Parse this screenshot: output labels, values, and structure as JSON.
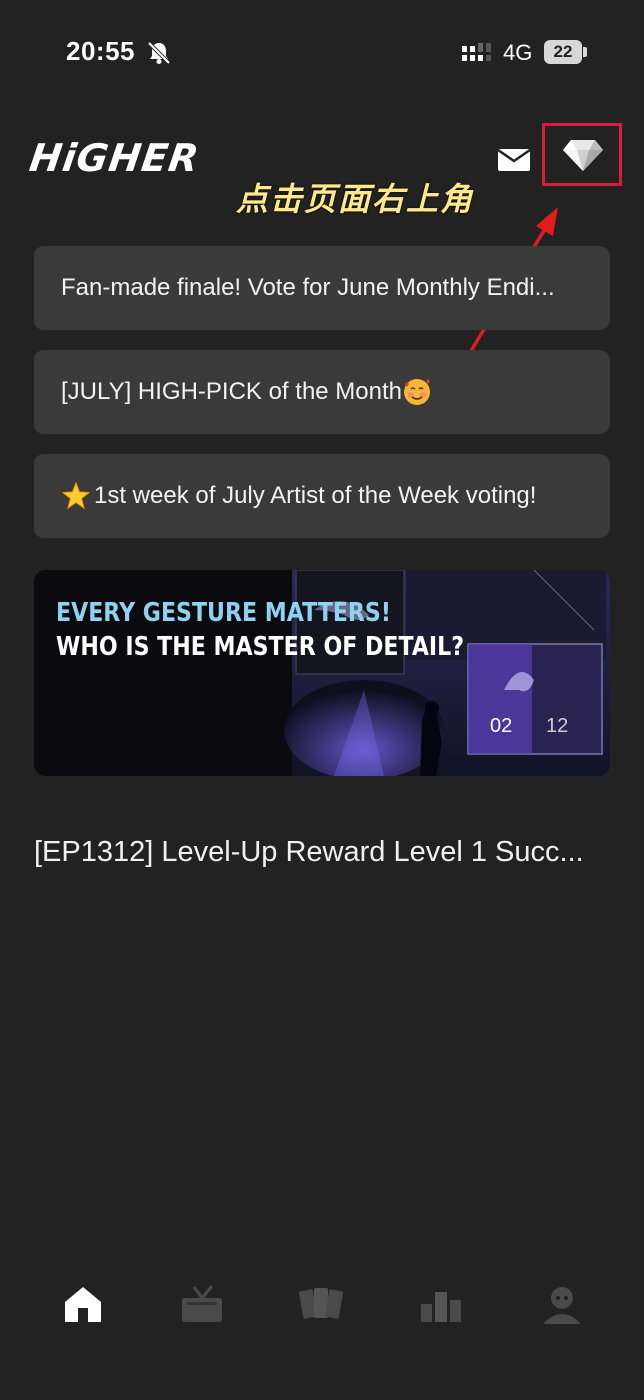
{
  "status": {
    "time": "20:55",
    "network": "4G",
    "battery": "22"
  },
  "header": {
    "logo": "HiGHER",
    "mail_icon": "mail-icon",
    "gem_icon": "diamond-icon",
    "annotation": "点击页面右上角",
    "highlight_color": "#d41f3a",
    "annotation_color": "#ffe98a"
  },
  "notices": [
    {
      "text": "Fan-made finale! Vote for June Monthly Endi..."
    },
    {
      "text": "[JULY] HIGH-PICK of the Month",
      "emoji_after": "smiling-face-with-hearts"
    },
    {
      "text": "1st week of July Artist of the Week voting!",
      "emoji_before": "glowing-star"
    }
  ],
  "banner": {
    "line1": "EVERY GESTURE MATTERS!",
    "line2": "WHO IS THE MASTER OF DETAIL?",
    "current": "02",
    "total": "12"
  },
  "feed": {
    "title": "[EP1312] Level-Up Reward Level 1 Succ..."
  },
  "tabs": [
    {
      "icon": "home-icon",
      "active": true
    },
    {
      "icon": "tv-icon",
      "active": false
    },
    {
      "icon": "cards-icon",
      "active": false
    },
    {
      "icon": "ranking-icon",
      "active": false
    },
    {
      "icon": "profile-icon",
      "active": false
    }
  ]
}
